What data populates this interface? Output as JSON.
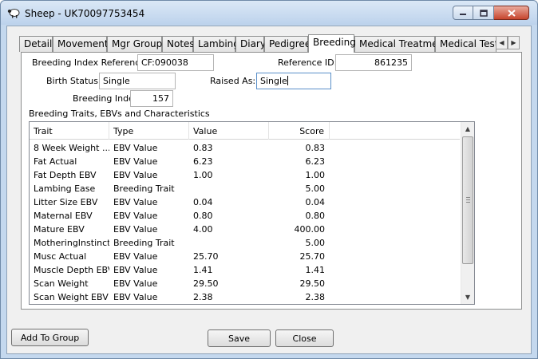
{
  "window": {
    "title": "Sheep - UK70097753454",
    "icon": "sheep-icon",
    "caption": {
      "minimize": "minimize-icon",
      "maximize": "maximize-icon",
      "close": "close-icon"
    }
  },
  "tabs": [
    {
      "label": "Details",
      "active": false
    },
    {
      "label": "Movements",
      "active": false
    },
    {
      "label": "Mgr Groups",
      "active": false
    },
    {
      "label": "Notes",
      "active": false
    },
    {
      "label": "Lambing",
      "active": false
    },
    {
      "label": "Diary",
      "active": false
    },
    {
      "label": "Pedigree",
      "active": false
    },
    {
      "label": "Breeding",
      "active": true
    },
    {
      "label": "Medical Treatment",
      "active": false
    },
    {
      "label": "Medical Tests",
      "active": false
    }
  ],
  "breeding": {
    "index_reference_label": "Breeding Index Reference:",
    "index_reference_value": "CF:090038",
    "reference_id_label": "Reference ID:",
    "reference_id_value": "861235",
    "birth_status_label": "Birth Status:",
    "birth_status_value": "Single",
    "raised_as_label": "Raised As:",
    "raised_as_value": "Single",
    "breeding_index_label": "Breeding Index:",
    "breeding_index_value": "157",
    "section_title": "Breeding Traits, EBVs and Characteristics"
  },
  "table": {
    "columns": [
      "Trait",
      "Type",
      "Value",
      "Score"
    ],
    "rows": [
      [
        "8 Week Weight ...",
        "EBV Value",
        "0.83",
        "0.83"
      ],
      [
        "Fat Actual",
        "EBV Value",
        "6.23",
        "6.23"
      ],
      [
        "Fat Depth EBV",
        "EBV Value",
        "1.00",
        "1.00"
      ],
      [
        "Lambing Ease",
        "Breeding Trait",
        "",
        "5.00"
      ],
      [
        "Litter Size EBV",
        "EBV Value",
        "0.04",
        "0.04"
      ],
      [
        "Maternal EBV",
        "EBV Value",
        "0.80",
        "0.80"
      ],
      [
        "Mature EBV",
        "EBV Value",
        "4.00",
        "400.00"
      ],
      [
        "MotheringInstinct",
        "Breeding Trait",
        "",
        "5.00"
      ],
      [
        "Musc Actual",
        "EBV Value",
        "25.70",
        "25.70"
      ],
      [
        "Muscle Depth EBV",
        "EBV Value",
        "1.41",
        "1.41"
      ],
      [
        "Scan Weight",
        "EBV Value",
        "29.50",
        "29.50"
      ],
      [
        "Scan Weight EBV",
        "EBV Value",
        "2.38",
        "2.38"
      ]
    ]
  },
  "buttons": {
    "add_to_group": "Add To Group",
    "save": "Save",
    "close": "Close"
  },
  "colors": {
    "title_bar": "#bcd2ec",
    "close_button": "#c7452d",
    "dialog_background": "#f0f0f0",
    "panel_background": "#ffffff"
  }
}
